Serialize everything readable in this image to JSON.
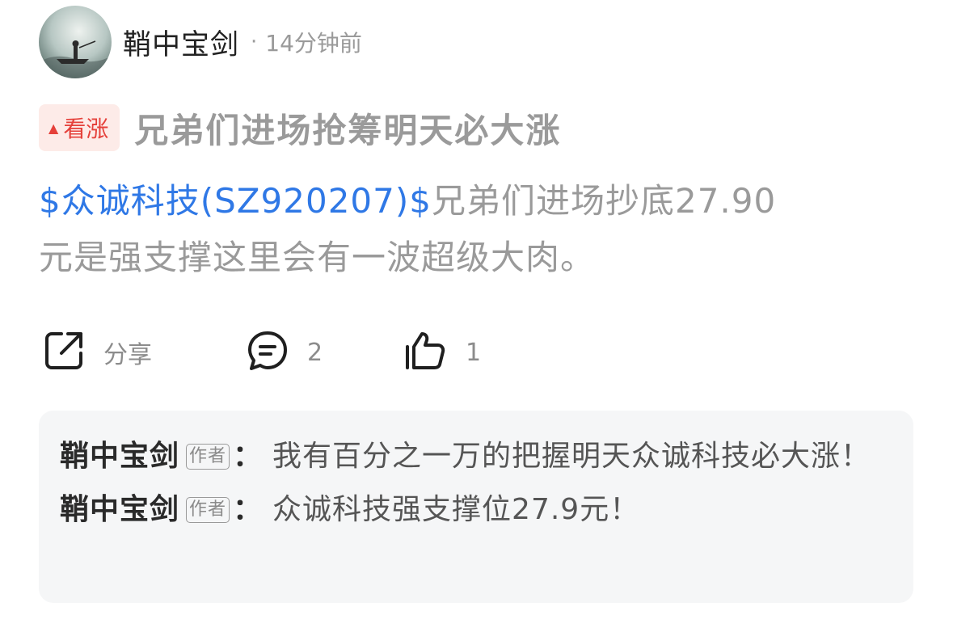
{
  "post": {
    "author": "鞘中宝剑",
    "separator": "·",
    "time": "14分钟前",
    "tag": {
      "label": "看涨",
      "icon": "triangle-up-icon",
      "color": "#e5403a"
    },
    "title": "兄弟们进场抢筹明天必大涨",
    "body": {
      "stock_link": "$众诚科技(SZ920207)$",
      "text_line1": "兄弟们进场抄底27.90",
      "text_line2": "元是强支撑这里会有一波超级大肉。"
    }
  },
  "actions": {
    "share": {
      "icon": "share-icon",
      "label": "分享"
    },
    "comment": {
      "icon": "comment-icon",
      "count": "2"
    },
    "like": {
      "icon": "thumbs-up-icon",
      "count": "1"
    }
  },
  "comments": [
    {
      "author": "鞘中宝剑",
      "badge": "作者",
      "colon": "：",
      "text": "我有百分之一万的把握明天众诚科技必大涨！"
    },
    {
      "author": "鞘中宝剑",
      "badge": "作者",
      "colon": "：",
      "text": "众诚科技强支撑位27.9元！"
    }
  ],
  "colors": {
    "link": "#2f78e6",
    "muted": "#9a9a9a",
    "tag_bg": "#fdebe8"
  }
}
